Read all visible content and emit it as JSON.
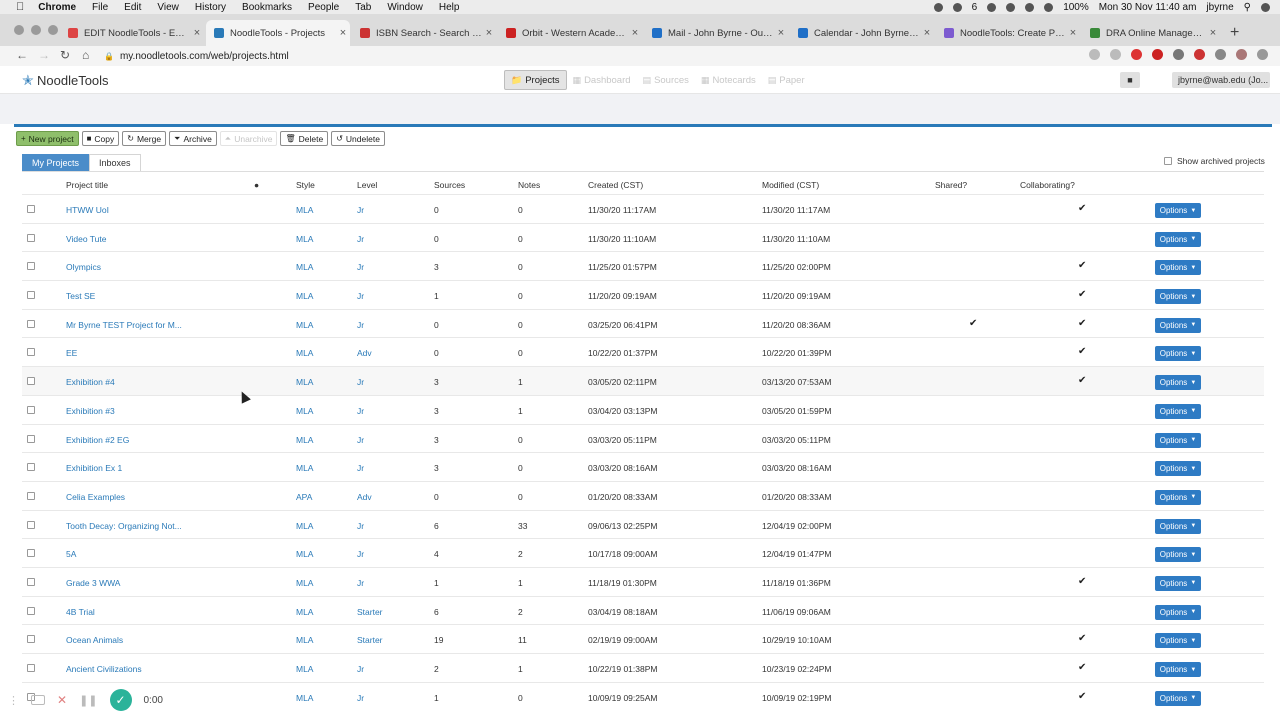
{
  "menubar": {
    "app": "Chrome",
    "items": [
      "File",
      "Edit",
      "View",
      "History",
      "Bookmarks",
      "People",
      "Tab",
      "Window",
      "Help"
    ],
    "battery": "100%",
    "datetime": "Mon 30 Nov  11:40 am",
    "user": "jbyrne",
    "badge": "6"
  },
  "tabs": [
    {
      "title": "EDIT NoodleTools - ES Libr",
      "color": "#d44"
    },
    {
      "title": "NoodleTools - Projects",
      "color": "#2a7ab8"
    },
    {
      "title": "ISBN Search - Search for B",
      "color": "#c33"
    },
    {
      "title": "Orbit - Western Academy o",
      "color": "#c22"
    },
    {
      "title": "Mail - John Byrne - Outlook",
      "color": "#1f6fc7"
    },
    {
      "title": "Calendar - John Byrne - Ou",
      "color": "#1f6fc7"
    },
    {
      "title": "NoodleTools: Create Project",
      "color": "#7d5bd0"
    },
    {
      "title": "DRA Online Management S",
      "color": "#3a8a3a"
    }
  ],
  "address": {
    "url": "my.noodletools.com/web/projects.html"
  },
  "app": {
    "logo": "NoodleTools",
    "nav": [
      {
        "label": "Projects",
        "icon": "folder-icon"
      },
      {
        "label": "Dashboard",
        "icon": "dashboard-icon"
      },
      {
        "label": "Sources",
        "icon": "sources-icon"
      },
      {
        "label": "Notecards",
        "icon": "notecards-icon"
      },
      {
        "label": "Paper",
        "icon": "paper-icon"
      }
    ],
    "user": "jbyrne@wab.edu (Jo..."
  },
  "actions": {
    "new_project": "New project",
    "copy": "Copy",
    "merge": "Merge",
    "archive": "Archive",
    "unarchive": "Unarchive",
    "delete": "Delete",
    "undelete": "Undelete"
  },
  "subtabs": {
    "my_projects": "My Projects",
    "inboxes": "Inboxes",
    "show_archived": "Show archived projects"
  },
  "table": {
    "headers": {
      "title": "Project title",
      "style": "Style",
      "level": "Level",
      "sources": "Sources",
      "notes": "Notes",
      "created": "Created (CST)",
      "modified": "Modified (CST)",
      "shared": "Shared?",
      "collab": "Collaborating?"
    },
    "options_label": "Options",
    "rows": [
      {
        "title": "HTWW UoI",
        "style": "MLA",
        "level": "Jr",
        "sources": "0",
        "notes": "0",
        "created": "11/30/20 11:17AM",
        "modified": "11/30/20 11:17AM",
        "shared": "",
        "collab": "✔"
      },
      {
        "title": "Video Tute",
        "style": "MLA",
        "level": "Jr",
        "sources": "0",
        "notes": "0",
        "created": "11/30/20 11:10AM",
        "modified": "11/30/20 11:10AM",
        "shared": "",
        "collab": ""
      },
      {
        "title": "Olympics",
        "style": "MLA",
        "level": "Jr",
        "sources": "3",
        "notes": "0",
        "created": "11/25/20 01:57PM",
        "modified": "11/25/20 02:00PM",
        "shared": "",
        "collab": "✔"
      },
      {
        "title": "Test SE",
        "style": "MLA",
        "level": "Jr",
        "sources": "1",
        "notes": "0",
        "created": "11/20/20 09:19AM",
        "modified": "11/20/20 09:19AM",
        "shared": "",
        "collab": "✔"
      },
      {
        "title": "Mr Byrne TEST Project for M...",
        "style": "MLA",
        "level": "Jr",
        "sources": "0",
        "notes": "0",
        "created": "03/25/20 06:41PM",
        "modified": "11/20/20 08:36AM",
        "shared": "✔",
        "collab": "✔"
      },
      {
        "title": "EE",
        "style": "MLA",
        "level": "Adv",
        "sources": "0",
        "notes": "0",
        "created": "10/22/20 01:37PM",
        "modified": "10/22/20 01:39PM",
        "shared": "",
        "collab": "✔"
      },
      {
        "title": "Exhibition #4",
        "style": "MLA",
        "level": "Jr",
        "sources": "3",
        "notes": "1",
        "created": "03/05/20 02:11PM",
        "modified": "03/13/20 07:53AM",
        "shared": "",
        "collab": "✔"
      },
      {
        "title": "Exhibition #3",
        "style": "MLA",
        "level": "Jr",
        "sources": "3",
        "notes": "1",
        "created": "03/04/20 03:13PM",
        "modified": "03/05/20 01:59PM",
        "shared": "",
        "collab": ""
      },
      {
        "title": "Exhibition #2 EG",
        "style": "MLA",
        "level": "Jr",
        "sources": "3",
        "notes": "0",
        "created": "03/03/20 05:11PM",
        "modified": "03/03/20 05:11PM",
        "shared": "",
        "collab": ""
      },
      {
        "title": "Exhibition Ex 1",
        "style": "MLA",
        "level": "Jr",
        "sources": "3",
        "notes": "0",
        "created": "03/03/20 08:16AM",
        "modified": "03/03/20 08:16AM",
        "shared": "",
        "collab": ""
      },
      {
        "title": "Celia Examples",
        "style": "APA",
        "level": "Adv",
        "sources": "0",
        "notes": "0",
        "created": "01/20/20 08:33AM",
        "modified": "01/20/20 08:33AM",
        "shared": "",
        "collab": ""
      },
      {
        "title": "Tooth Decay: Organizing Not...",
        "style": "MLA",
        "level": "Jr",
        "sources": "6",
        "notes": "33",
        "created": "09/06/13 02:25PM",
        "modified": "12/04/19 02:00PM",
        "shared": "",
        "collab": ""
      },
      {
        "title": "5A",
        "style": "MLA",
        "level": "Jr",
        "sources": "4",
        "notes": "2",
        "created": "10/17/18 09:00AM",
        "modified": "12/04/19 01:47PM",
        "shared": "",
        "collab": ""
      },
      {
        "title": "Grade 3 WWA",
        "style": "MLA",
        "level": "Jr",
        "sources": "1",
        "notes": "1",
        "created": "11/18/19 01:30PM",
        "modified": "11/18/19 01:36PM",
        "shared": "",
        "collab": "✔"
      },
      {
        "title": "4B Trial",
        "style": "MLA",
        "level": "Starter",
        "sources": "6",
        "notes": "2",
        "created": "03/04/19 08:18AM",
        "modified": "11/06/19 09:06AM",
        "shared": "",
        "collab": ""
      },
      {
        "title": "Ocean Animals",
        "style": "MLA",
        "level": "Starter",
        "sources": "19",
        "notes": "11",
        "created": "02/19/19 09:00AM",
        "modified": "10/29/19 10:10AM",
        "shared": "",
        "collab": "✔"
      },
      {
        "title": "Ancient Civilizations",
        "style": "MLA",
        "level": "Jr",
        "sources": "2",
        "notes": "1",
        "created": "10/22/19 01:38PM",
        "modified": "10/23/19 02:24PM",
        "shared": "",
        "collab": "✔"
      },
      {
        "title": "",
        "style": "MLA",
        "level": "Jr",
        "sources": "1",
        "notes": "0",
        "created": "10/09/19 09:25AM",
        "modified": "10/09/19 02:19PM",
        "shared": "",
        "collab": "✔"
      }
    ]
  },
  "recorder": {
    "time": "0:00"
  }
}
